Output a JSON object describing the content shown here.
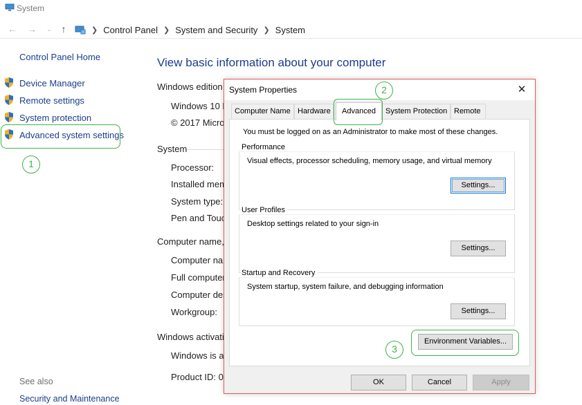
{
  "window": {
    "title": "System"
  },
  "nav": {
    "breadcrumbs": [
      "Control Panel",
      "System and Security",
      "System"
    ]
  },
  "sidebar": {
    "home_link": "Control Panel Home",
    "items": [
      {
        "label": "Device Manager",
        "icon": "shield-icon"
      },
      {
        "label": "Remote settings",
        "icon": "shield-icon"
      },
      {
        "label": "System protection",
        "icon": "shield-icon"
      },
      {
        "label": "Advanced system settings",
        "icon": "shield-icon"
      }
    ],
    "see_also": "See also",
    "see_also_link": "Security and Maintenance"
  },
  "main": {
    "title": "View basic information about your computer",
    "windows_edition": {
      "heading": "Windows edition",
      "rows": [
        "Windows 10 E",
        "© 2017 Micro"
      ]
    },
    "system": {
      "heading": "System",
      "rows": [
        "Processor:",
        "Installed mem",
        "System type:",
        "Pen and Touch"
      ]
    },
    "computer_name": {
      "heading": "Computer name, d",
      "rows": [
        "Computer nar",
        "Full computer",
        "Computer des",
        "Workgroup:"
      ]
    },
    "activation": {
      "heading": "Windows activatio",
      "rows": [
        "Windows is ac",
        "Product ID: 00"
      ]
    }
  },
  "annotations": {
    "step1": "1",
    "step2": "2",
    "step3": "3",
    "color": "#3fb24a"
  },
  "dialog": {
    "title": "System Properties",
    "close": "✕",
    "tabs": [
      "Computer Name",
      "Hardware",
      "Advanced",
      "System Protection",
      "Remote"
    ],
    "active_tab": "Advanced",
    "admin_note": "You must be logged on as an Administrator to make most of these changes.",
    "groups": [
      {
        "label": "Performance",
        "desc": "Visual effects, processor scheduling, memory usage, and virtual memory",
        "button": "Settings..."
      },
      {
        "label": "User Profiles",
        "desc": "Desktop settings related to your sign-in",
        "button": "Settings..."
      },
      {
        "label": "Startup and Recovery",
        "desc": "System startup, system failure, and debugging information",
        "button": "Settings..."
      }
    ],
    "env_button": "Environment Variables...",
    "ok": "OK",
    "cancel": "Cancel",
    "apply": "Apply",
    "border_color": "#e05a5a"
  }
}
